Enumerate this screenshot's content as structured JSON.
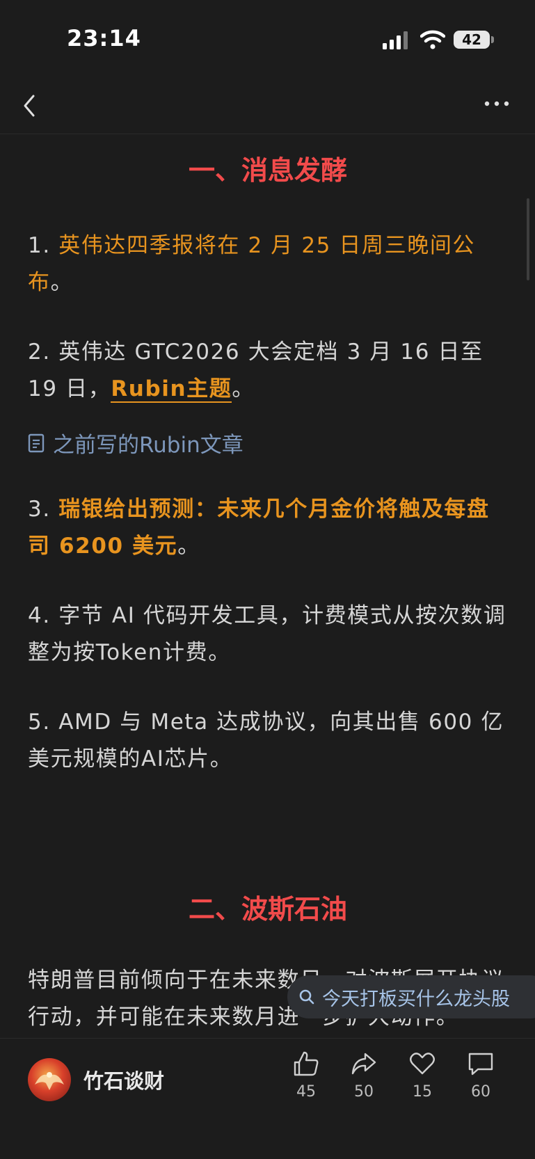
{
  "status": {
    "time": "23:14",
    "battery": "42"
  },
  "article": {
    "section1_title": "一、消息发酵",
    "p1_num": "1. ",
    "p1_text": "英伟达四季报将在 2 月 25 日周三晚间公布",
    "p1_end": "。",
    "p2_text": "2. 英伟达 GTC2026 大会定档 3 月 16 日至 19 日，",
    "p2_link": "Rubin主题",
    "p2_end": "。",
    "doc_link": "之前写的Rubin文章",
    "p3_num": "3. ",
    "p3_text": "瑞银给出预测：未来几个月金价将触及每盘司 6200 美元",
    "p3_end": "。",
    "p4_text": "4. 字节 AI 代码开发工具，计费模式从按次数调整为按Token计费。",
    "p5_text": "5. AMD 与 Meta 达成协议，向其出售 600 亿美元规模的AI芯片。",
    "section2_title": "二、波斯石油",
    "p6_text": "特朗普目前倾向于在未来数日，对波斯展开协议行动，并可能在未来数月进一步扩大动作。"
  },
  "suggest": {
    "label": "今天打板买什么龙头股"
  },
  "footer": {
    "author": "竹石谈财",
    "like_count": "45",
    "share_count": "50",
    "fav_count": "15",
    "comment_count": "60"
  },
  "colors": {
    "title_red": "#f24b4b",
    "highlight_orange": "#e8941f",
    "link_blue": "#7d97bb",
    "bg": "#1c1c1c"
  }
}
